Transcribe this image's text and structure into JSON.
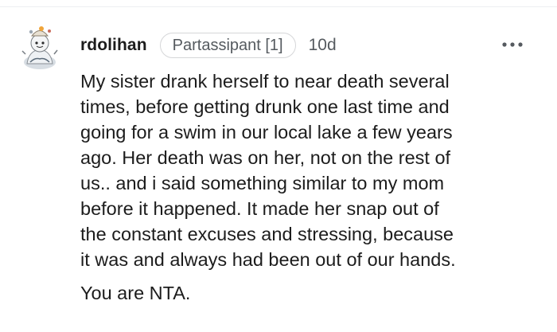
{
  "comment": {
    "username": "rdolihan",
    "flair": "Partassipant [1]",
    "age": "10d",
    "more_icon": "more-horizontal-icon",
    "paragraphs": [
      {
        "lines": [
          "My sister drank herself to near death several",
          "times, before getting drunk one last time and",
          "going for a swim in our local lake a few years",
          "ago. Her death was on her, not on the rest of",
          "us.. and i said something similar to my mom",
          "before it happened. It made her snap out of",
          "the constant excuses and stressing, because",
          "it was and always had been out of our hands."
        ]
      },
      {
        "lines": [
          "You are NTA."
        ]
      }
    ]
  },
  "colors": {
    "text": "#1c1c1c",
    "meta": "#555a5f",
    "flair_border": "#d5d6d8",
    "divider": "#edeff1"
  }
}
